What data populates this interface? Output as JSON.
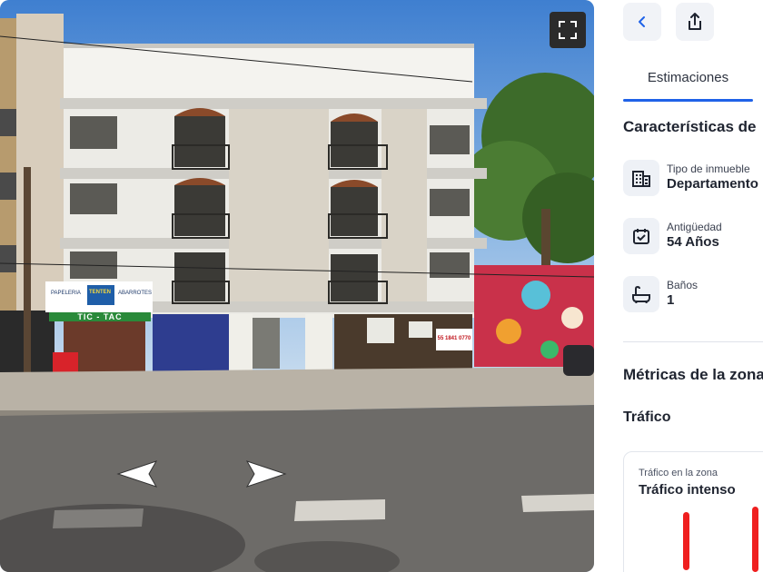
{
  "toolbar": {
    "back_icon": "chevron-left-icon",
    "share_icon": "share-icon"
  },
  "streetview": {
    "fullscreen_icon": "fullscreen-icon",
    "signs": {
      "kiosk_banner": "TIC - TAC",
      "store_sign_left": "PAPELERIA",
      "store_sign_right": "ABARROTES",
      "store_sign_center": "TENTEN",
      "phone": "55 1841 0770"
    }
  },
  "tabs": [
    {
      "label": "Estimaciones",
      "active": true
    }
  ],
  "features": {
    "title": "Características de",
    "items": [
      {
        "label": "Tipo de inmueble",
        "value": "Departamento",
        "icon": "building-icon"
      },
      {
        "label": "Antigüedad",
        "value": "54 Años",
        "icon": "calendar-check-icon"
      },
      {
        "label": "Baños",
        "value": "1",
        "icon": "bathtub-icon"
      }
    ]
  },
  "metrics": {
    "title": "Métricas de la zona",
    "traffic_title": "Tráfico",
    "traffic_card": {
      "label": "Tráfico en la zona",
      "value": "Tráfico intenso",
      "bar_color": "#ef1f1f"
    }
  },
  "colors": {
    "accent": "#1f62e8",
    "traffic_high": "#ef1f1f"
  }
}
